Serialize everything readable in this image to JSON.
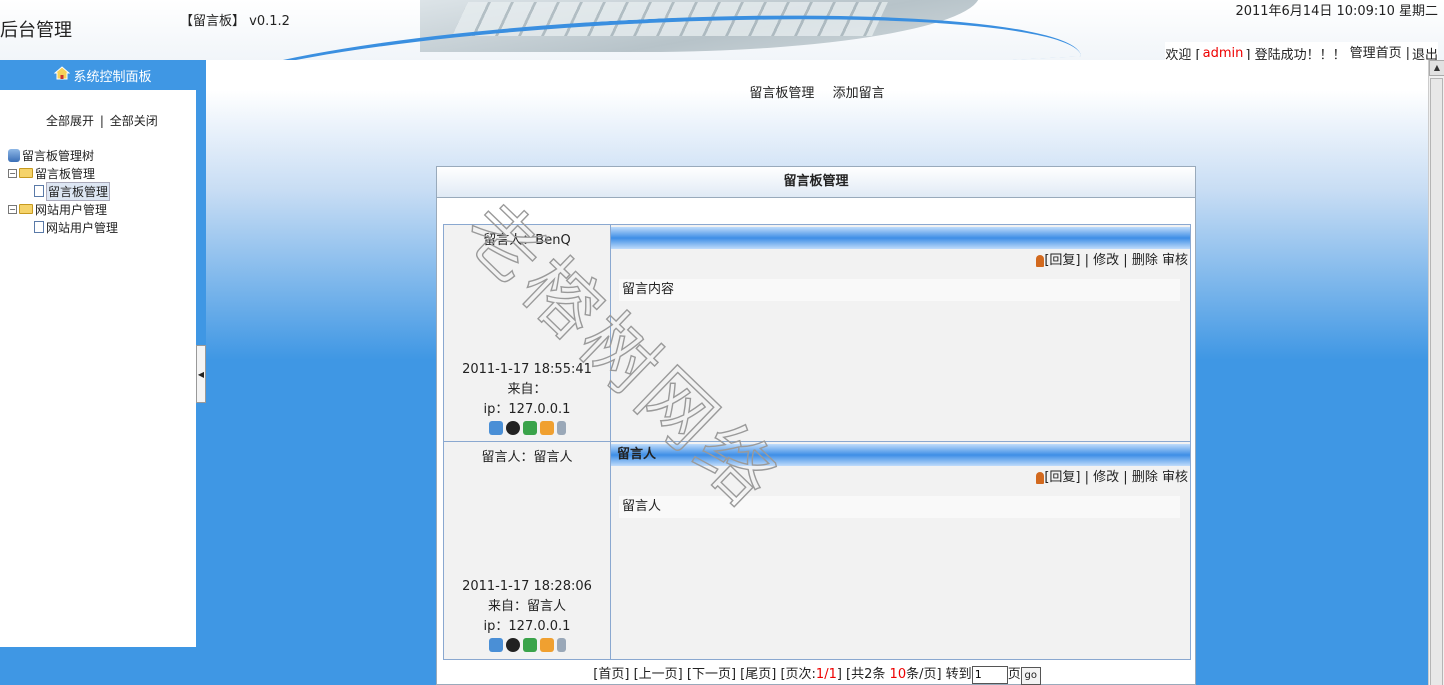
{
  "header": {
    "app_title": "后台管理",
    "app_version": "【留言板】 v0.1.2",
    "datetime": "2011年6月14日 10:09:10 星期二",
    "welcome_prefix": "欢迎 [",
    "username": "admin",
    "welcome_suffix": "] 登陆成功！！！",
    "nav_home": "管理首页",
    "nav_sep": "|",
    "nav_logout": "退出"
  },
  "sidebar": {
    "title": "系统控制面板",
    "expand_all": "全部展开",
    "sep": "|",
    "collapse_all": "全部关闭",
    "tree": {
      "root": "留言板管理树",
      "group1": "留言板管理",
      "group1_item": "留言板管理",
      "group2": "网站用户管理",
      "group2_item": "网站用户管理"
    }
  },
  "topnav": {
    "manage": "留言板管理",
    "add": "添加留言"
  },
  "panel": {
    "title": "留言板管理",
    "actions": {
      "reply": "[回复]",
      "sep": "|",
      "edit": "修改",
      "delete": "删除",
      "audit": "审核"
    },
    "messages": [
      {
        "author_line": "留言人：BenQ",
        "title": "",
        "content": "留言内容",
        "time": "2011-1-17 18:55:41",
        "from": "来自：",
        "ip": "ip：127.0.0.1"
      },
      {
        "author_line": "留言人：留言人",
        "title": "留言人",
        "content": "留言人",
        "time": "2011-1-17 18:28:06",
        "from": "来自：留言人",
        "ip": "ip：127.0.0.1"
      }
    ]
  },
  "pager": {
    "first": "[首页]",
    "prev": "[上一页]",
    "next": "[下一页]",
    "last": "[尾页]",
    "page_label": "[页次:",
    "page_value": "1/1",
    "total_label": "] [共2条",
    "per_page": "10",
    "per_page_suffix": "条/页] 转到",
    "input_value": "1",
    "page_suffix": "页",
    "go": "go"
  },
  "watermark": "老榕树网络",
  "colors": {
    "accent": "#3f97e4",
    "red": "#ee0000"
  }
}
